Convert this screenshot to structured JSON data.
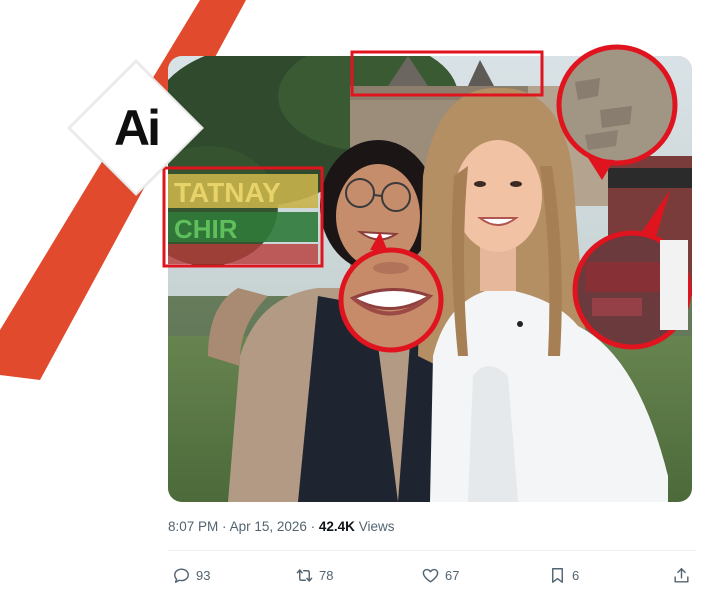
{
  "badge": {
    "text": "Ai"
  },
  "photo": {
    "description_alt": "Two women smiling outdoors in front of a monument",
    "sign_letters_top": "TATNAY",
    "sign_letters_bottom": "CHIR"
  },
  "tweet": {
    "time": "8:07 PM",
    "separator": "·",
    "date": "Apr 15, 2026",
    "separator2": "·",
    "views_count": "42.4K",
    "views_label": "Views"
  },
  "actions": {
    "replies": "93",
    "retweets": "78",
    "likes": "67",
    "bookmarks": "6"
  },
  "colors": {
    "highlight_red": "#e0141e",
    "ribbon_red": "#e24a2e",
    "meta_gray": "#536471"
  }
}
